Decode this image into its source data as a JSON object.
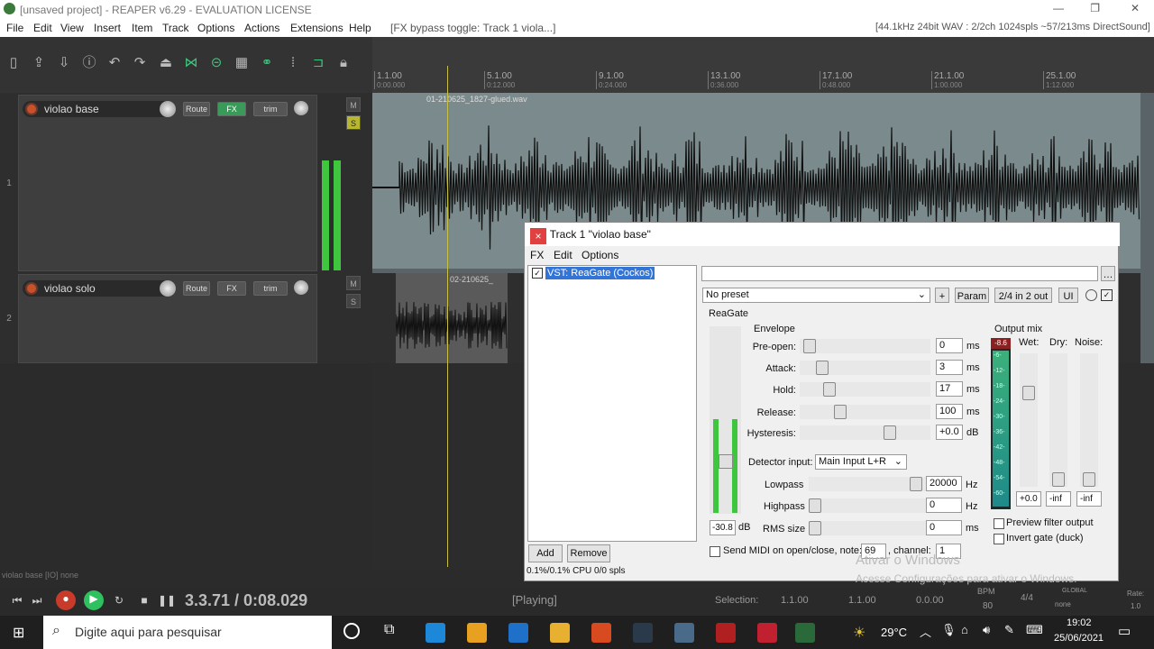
{
  "app_title": "[unsaved project] - REAPER v6.29 - EVALUATION LICENSE",
  "window_controls": {
    "min": "—",
    "max": "❐",
    "close": "✕"
  },
  "menu": [
    "File",
    "Edit",
    "View",
    "Insert",
    "Item",
    "Track",
    "Options",
    "Actions",
    "Extensions",
    "Help"
  ],
  "menu_status": "[FX bypass toggle: Track 1 viola...]",
  "audio_status": "[44.1kHz 24bit WAV : 2/2ch 1024spls ~57/213ms DirectSound]",
  "tracks": [
    {
      "num": "1",
      "name": "violao base",
      "route": "Route",
      "fx": "FX",
      "trim": "trim",
      "mute": "M",
      "solo": "S"
    },
    {
      "num": "2",
      "name": "violao solo",
      "route": "Route",
      "fx": "FX",
      "trim": "trim",
      "mute": "M",
      "solo": "S"
    }
  ],
  "ruler": [
    {
      "bar": "1.1.00",
      "time": "0:00.000"
    },
    {
      "bar": "5.1.00",
      "time": "0:12.000"
    },
    {
      "bar": "9.1.00",
      "time": "0:24.000"
    },
    {
      "bar": "13.1.00",
      "time": "0:36.000"
    },
    {
      "bar": "17.1.00",
      "time": "0:48.000"
    },
    {
      "bar": "21.1.00",
      "time": "1:00.000"
    },
    {
      "bar": "25.1.00",
      "time": "1:12.000"
    }
  ],
  "items": {
    "item1": "01-210625_1827-glued.wav",
    "item2": "02-210625_"
  },
  "fx": {
    "title": "FX: Track 1 \"violao base\"",
    "close": "×",
    "menu": [
      "FX",
      "Edit",
      "Options"
    ],
    "chain_item": "VST: ReaGate (Cockos)",
    "preset": "No preset",
    "plus": "+",
    "param": "Param",
    "io": "2/4 in 2 out",
    "ui": "UI",
    "plugin_name": "ReaGate",
    "envelope_label": "Envelope",
    "params": [
      {
        "label": "Pre-open:",
        "value": "0",
        "unit": "ms"
      },
      {
        "label": "Attack:",
        "value": "3",
        "unit": "ms"
      },
      {
        "label": "Hold:",
        "value": "17",
        "unit": "ms"
      },
      {
        "label": "Release:",
        "value": "100",
        "unit": "ms"
      },
      {
        "label": "Hysteresis:",
        "value": "+0.0",
        "unit": "dB"
      }
    ],
    "threshold": "-30.8",
    "threshold_unit": "dB",
    "detector_label": "Detector input:",
    "detector_value": "Main Input L+R",
    "lowpass": {
      "label": "Lowpass",
      "value": "20000",
      "unit": "Hz"
    },
    "highpass": {
      "label": "Highpass",
      "value": "0",
      "unit": "Hz"
    },
    "rms": {
      "label": "RMS size",
      "value": "0",
      "unit": "ms"
    },
    "output_mix": "Output mix",
    "meter_top": "-8.6",
    "meter_scale": [
      "-6-",
      "-12-",
      "-18-",
      "-24-",
      "-30-",
      "-36-",
      "-42-",
      "-48-",
      "-54-",
      "-60-"
    ],
    "wet": {
      "label": "Wet:",
      "value": "+0.0"
    },
    "dry": {
      "label": "Dry:",
      "value": "-inf"
    },
    "noise": {
      "label": "Noise:",
      "value": "-inf"
    },
    "preview": "Preview filter output",
    "invert": "Invert gate (duck)",
    "midi": "Send MIDI on open/close, note:",
    "midi_note": "69",
    "channel_label": ", channel:",
    "channel": "1",
    "add": "Add",
    "remove": "Remove",
    "cpu": "0.1%/0.1% CPU 0/0 spls"
  },
  "status_left": "violao base [IO] none",
  "transport": {
    "time": "3.3.71 / 0:08.029",
    "state": "[Playing]",
    "selection_label": "Selection:",
    "sel_start": "1.1.00",
    "sel_end": "1.1.00",
    "sel_len": "0.0.00",
    "bpm_label": "BPM",
    "bpm": "80",
    "sig": "4/4",
    "global": "GLOBAL",
    "none": "none",
    "rate_label": "Rate:",
    "rate": "1.0"
  },
  "watermark": {
    "line1": "Ativar o Windows",
    "line2": "Acesse Configurações para ativar o Windows."
  },
  "taskbar": {
    "search": "Digite aqui para pesquisar",
    "temp": "29°C",
    "time": "19:02",
    "date": "25/06/2021"
  },
  "colors": {
    "accent": "#3ec77e",
    "meter": "#3ec63e",
    "record": "#c8502a"
  }
}
